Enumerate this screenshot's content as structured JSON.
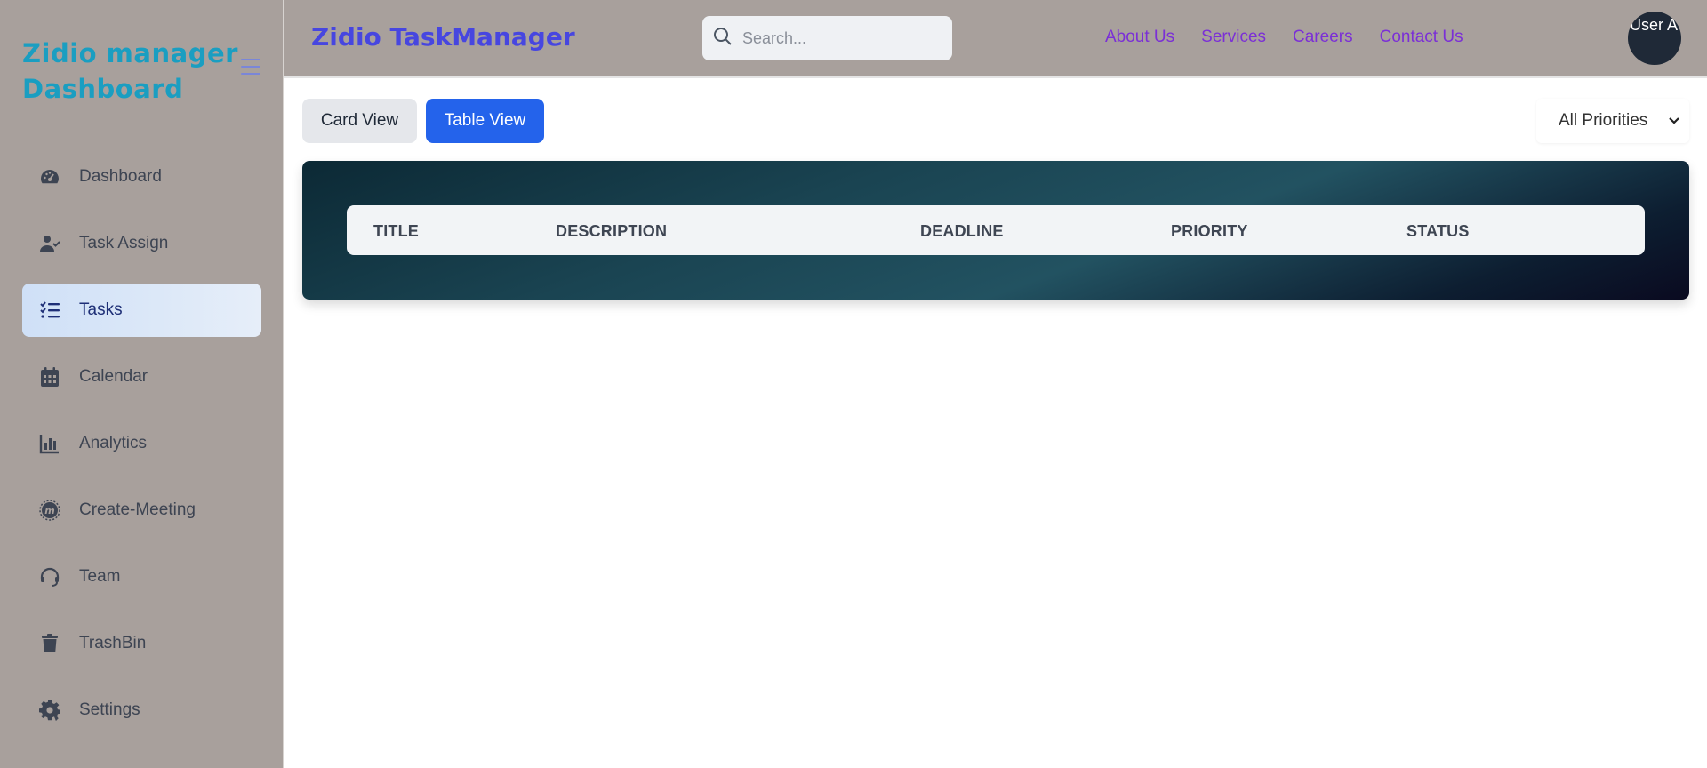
{
  "sidebar": {
    "brand": "Zidio manager Dashboard",
    "items": [
      {
        "label": "Dashboard",
        "icon": "gauge-icon"
      },
      {
        "label": "Task Assign",
        "icon": "user-check-icon"
      },
      {
        "label": "Tasks",
        "icon": "list-check-icon",
        "active": true
      },
      {
        "label": "Calendar",
        "icon": "calendar-icon"
      },
      {
        "label": "Analytics",
        "icon": "bar-chart-icon"
      },
      {
        "label": "Create-Meeting",
        "icon": "meeting-icon"
      },
      {
        "label": "Team",
        "icon": "headset-icon"
      },
      {
        "label": "TrashBin",
        "icon": "trash-icon"
      },
      {
        "label": "Settings",
        "icon": "gear-icon"
      }
    ]
  },
  "header": {
    "title": "Zidio TaskManager",
    "search_placeholder": "Search...",
    "links": [
      "About Us",
      "Services",
      "Careers",
      "Contact Us"
    ],
    "avatar_alt": "User Avatar"
  },
  "toolbar": {
    "card_view_label": "Card View",
    "table_view_label": "Table View",
    "priority_filter": "All Priorities"
  },
  "table": {
    "columns": [
      "TITLE",
      "DESCRIPTION",
      "DEADLINE",
      "PRIORITY",
      "STATUS"
    ]
  },
  "colors": {
    "sidebar_bg": "#a8a09c",
    "brand": "#1a9ec1",
    "title": "#4746e0",
    "link": "#7b2fd6",
    "primary_button": "#2463eb"
  }
}
